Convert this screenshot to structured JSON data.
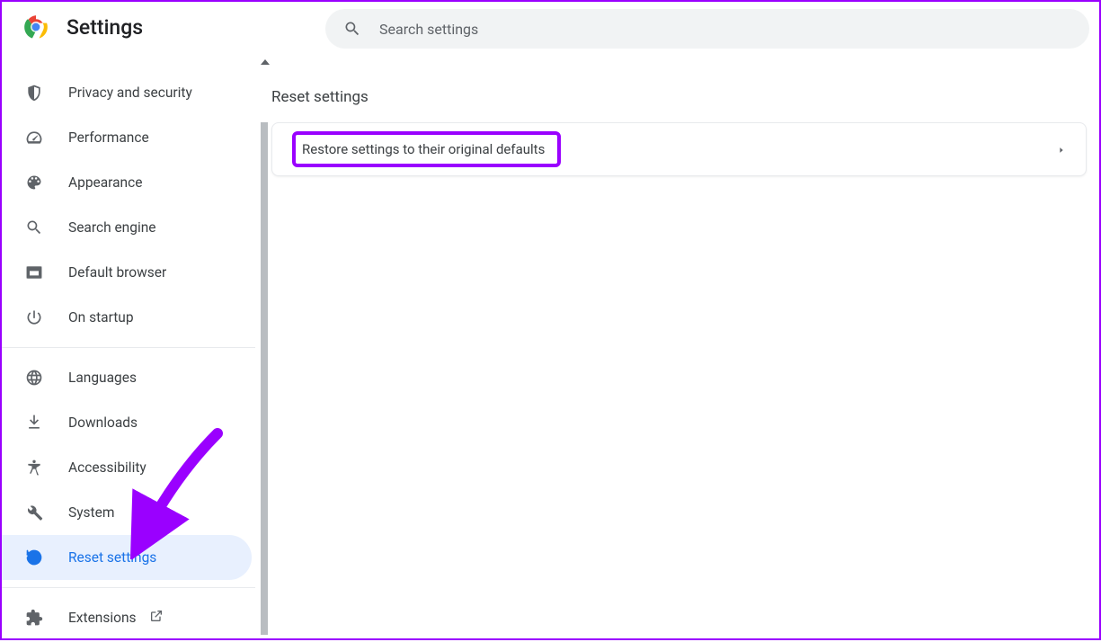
{
  "header": {
    "title": "Settings"
  },
  "search": {
    "placeholder": "Search settings"
  },
  "sidebar": {
    "group1": [
      {
        "id": "privacy",
        "label": "Privacy and security",
        "icon": "shield-icon"
      },
      {
        "id": "performance",
        "label": "Performance",
        "icon": "speedometer-icon"
      },
      {
        "id": "appearance",
        "label": "Appearance",
        "icon": "palette-icon"
      },
      {
        "id": "search-engine",
        "label": "Search engine",
        "icon": "search-icon"
      },
      {
        "id": "default-browser",
        "label": "Default browser",
        "icon": "browser-icon"
      },
      {
        "id": "on-startup",
        "label": "On startup",
        "icon": "power-icon"
      }
    ],
    "group2": [
      {
        "id": "languages",
        "label": "Languages",
        "icon": "globe-icon"
      },
      {
        "id": "downloads",
        "label": "Downloads",
        "icon": "download-icon"
      },
      {
        "id": "accessibility",
        "label": "Accessibility",
        "icon": "accessibility-icon"
      },
      {
        "id": "system",
        "label": "System",
        "icon": "wrench-icon"
      },
      {
        "id": "reset",
        "label": "Reset settings",
        "icon": "history-icon",
        "active": true
      }
    ],
    "group3": [
      {
        "id": "extensions",
        "label": "Extensions",
        "icon": "puzzle-icon",
        "external": true
      }
    ]
  },
  "main": {
    "section_title": "Reset settings",
    "card_label": "Restore settings to their original defaults"
  },
  "annotations": {
    "highlight_color": "#9a00ff",
    "arrow_points_to": "reset-settings-sidebar-item"
  }
}
